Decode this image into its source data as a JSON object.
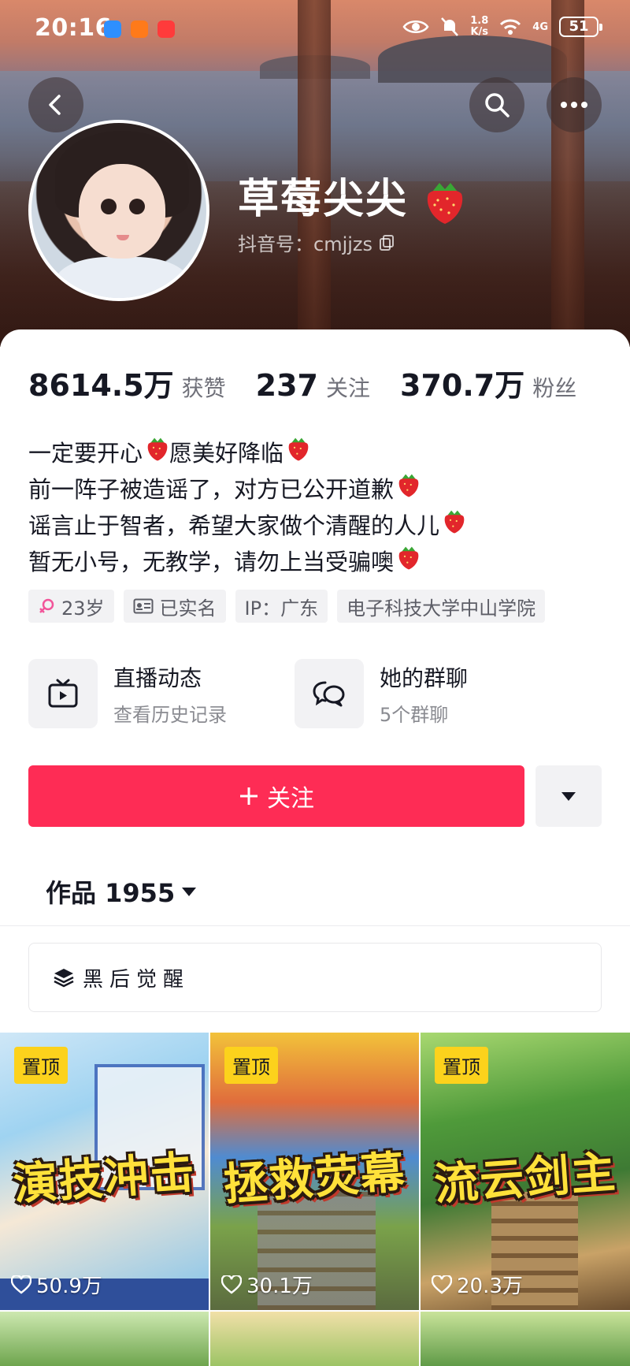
{
  "status_bar": {
    "time": "20:16",
    "speed": "1.8\nK/s",
    "network": "4G",
    "battery": "51"
  },
  "profile": {
    "nickname": "草莓尖尖",
    "douyin_id": "抖音号：cmjjzs"
  },
  "stats": [
    {
      "value": "8614.5万",
      "label": "获赞"
    },
    {
      "value": "237",
      "label": "关注"
    },
    {
      "value": "370.7万",
      "label": "粉丝"
    }
  ],
  "bio": [
    "一定要开心🍓愿美好降临🍓",
    "前一阵子被造谣了，对方已公开道歉🍓",
    "谣言止于智者，希望大家做个清醒的人儿🍓",
    "暂无小号，无教学，请勿上当受骗噢🍓"
  ],
  "bio_parts": {
    "l1a": "一定要开心",
    "l1b": "愿美好降临",
    "l2": "前一阵子被造谣了，对方已公开道歉",
    "l3": "谣言止于智者，希望大家做个清醒的人儿",
    "l4": "暂无小号，无教学，请勿上当受骗噢"
  },
  "tags": {
    "age": "23岁",
    "verified": "已实名",
    "ip": "IP：广东",
    "school": "电子科技大学中山学院"
  },
  "features": {
    "live": {
      "title": "直播动态",
      "subtitle": "查看历史记录"
    },
    "group": {
      "title": "她的群聊",
      "subtitle": "5个群聊"
    }
  },
  "actions": {
    "follow_label": "关注"
  },
  "works": {
    "tab_label": "作品 1955",
    "collection_label": "黑后觉醒"
  },
  "videos": [
    {
      "pin": "置顶",
      "title": "演技冲击",
      "likes": "50.9万"
    },
    {
      "pin": "置顶",
      "title": "拯救荧幕",
      "likes": "30.1万"
    },
    {
      "pin": "置顶",
      "title": "流云剑主",
      "likes": "20.3万"
    }
  ],
  "colors": {
    "accent": "#fe2c55",
    "pin_bg": "#fcd21c",
    "title_yellow": "#ffe13a"
  },
  "icons": [
    "back-icon",
    "search-icon",
    "more-icon",
    "copy-icon",
    "female-icon",
    "id-card-icon",
    "tv-icon",
    "chat-bubbles-icon",
    "plus-icon",
    "caret-down-icon",
    "layers-icon",
    "heart-icon",
    "strawberry-icon"
  ]
}
